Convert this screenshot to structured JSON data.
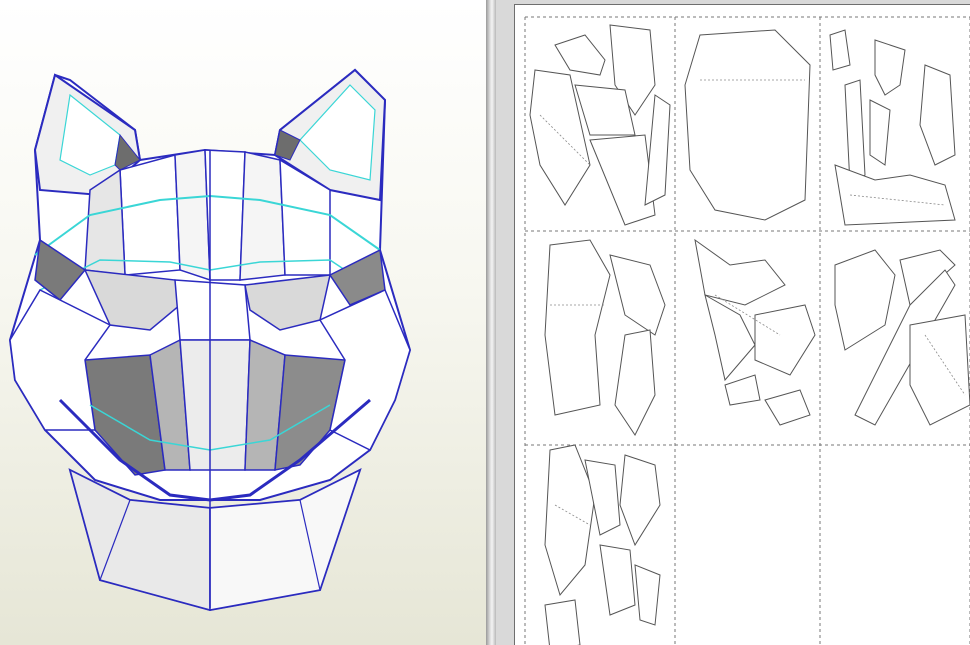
{
  "app": {
    "panes": [
      "3d-view",
      "2d-unfold-view"
    ]
  },
  "view3d": {
    "model": "wolf-mask",
    "colors": {
      "background_top": "#ffffff",
      "background_bottom": "#e6e6d6",
      "edge_blue": "#2b2bbf",
      "edge_cyan": "#3ad6d6",
      "face_light": "#ffffff",
      "face_mid": "#c8c8c8",
      "face_dark": "#6d6d6d"
    }
  },
  "view2d": {
    "page_grid": {
      "columns": 3,
      "rows": 3
    },
    "colors": {
      "page": "#ffffff",
      "cut_line": "#555555",
      "fold_line": "#8a8a8a",
      "page_border": "#777777"
    }
  }
}
